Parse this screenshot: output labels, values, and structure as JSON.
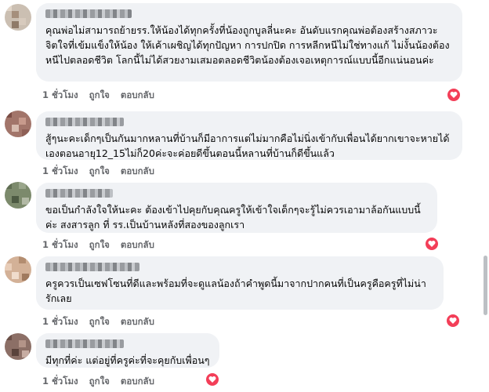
{
  "comments": [
    {
      "text": "คุณพ่อไม่สามารถย้ายรร.ให้น้องได้ทุกครั้งที่น้องถูกบูลลี่นะคะ อันดับแรกคุณพ่อต้องสร้างสภาวะจิตใจที่เข้มแข็งให้น้อง ให้เค้าเผชิญได้ทุกปัญหา การปกปิด การหลีกหนีไม่ใช่ทางแก้ ไม่งั้นน้องต้องหนีไปตลอดชีวิต โลกนี้ไม่ได้สวยงามเสมอตลอดชีวิตน้องต้องเจอเหตุการณ์แบบนี้อีกแน่นอนค่ะ",
      "time": "1 ชั่วโมง",
      "like": "ถูกใจ",
      "reply": "ตอบกลับ",
      "reaction_icon": "love-heart-icon"
    },
    {
      "text": "สู้ๆนะคะเด็กๆเป็นกันมากหลานที่บ้านก็มีอาการแต่ไม่มากคือไม่นิ่งเข้ากับเพื่อนได้ยากเขาจะหายได้เองตอนอายุ12_15ไม่ก็20ค่ะจะค่อยดีขึ้นตอนนี้หลานที่บ้านก็ดีขึ้นแล้ว",
      "time": "1 ชั่วโมง",
      "like": "ถูกใจ",
      "reply": "ตอบกลับ",
      "reaction_icon": ""
    },
    {
      "text": "ขอเป็นกำลังใจให้นะคะ ต้องเข้าไปคุยกับคุณครูให้เข้าใจเด็กๆจะรู้ไม่ควรเอามาล้อกันแบบนี้ค่ะ สงสารลูก ที่ รร.เป็นบ้านหลังที่สองของลูกเรา",
      "time": "1 ชั่วโมง",
      "like": "ถูกใจ",
      "reply": "ตอบกลับ",
      "reaction_icon": "love-heart-icon"
    },
    {
      "text": "ครูควรเป็นเซฟโซนที่ดีและพร้อมที่จะดูแลน้องถ้าคำพูดนี้มาจากปากคนที่เป็นครูคือครูที่ไม่น่ารักเลย",
      "time": "1 ชั่วโมง",
      "like": "ถูกใจ",
      "reply": "ตอบกลับ",
      "reaction_icon": "love-heart-icon"
    },
    {
      "text": "มีทุกที่ค่ะ แต่อยู่ที่ครูค่ะที่จะคุยกับเพื่อนๆ",
      "time": "1 ชั่วโมง",
      "like": "ถูกใจ",
      "reply": "ตอบกลับ",
      "reaction_icon": "love-heart-icon"
    }
  ],
  "colors": {
    "bubble": "#f0f2f5",
    "meta_text": "#65676b",
    "love_reaction": "#f33e58"
  }
}
